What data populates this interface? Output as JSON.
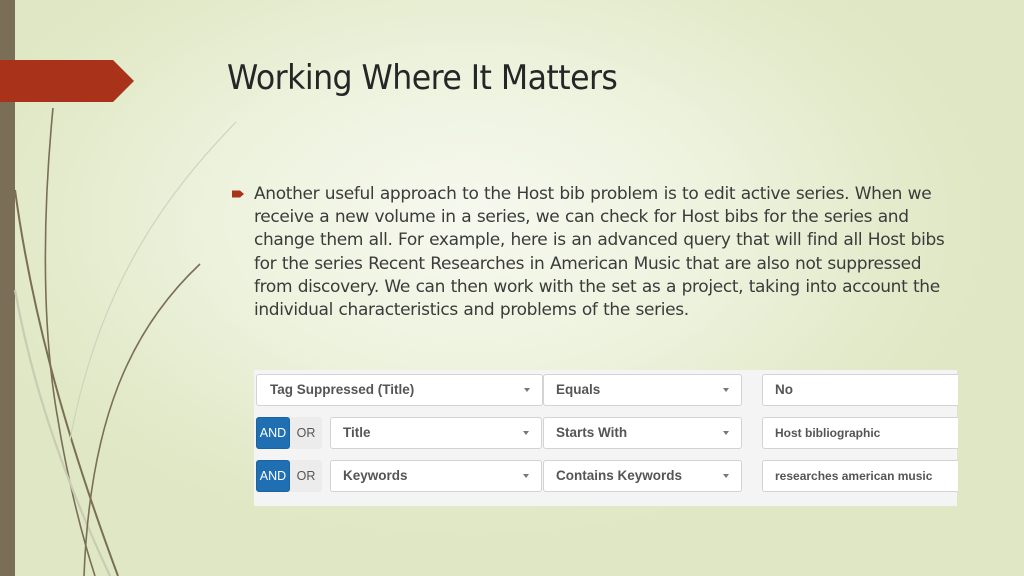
{
  "slide": {
    "title": "Working Where It Matters",
    "bullets": [
      {
        "icon": "arrow-bullet-icon",
        "text": "Another useful approach to the Host bib problem is to edit active series. When we receive a new volume in a series, we can check for Host bibs for the series and change them all.  For example, here is an advanced query that will find all Host bibs for the series Recent Researches in American Music that are also not suppressed from discovery.  We can then work with the set as a project, taking into account the individual characteristics and problems of the series."
      }
    ],
    "colors": {
      "accent": "#a8321a",
      "sidebar": "#7a6e57",
      "background": "#eef3df",
      "text": "#3b3b3b"
    }
  },
  "query_builder": {
    "rows": [
      {
        "field": "Tag Suppressed (Title)",
        "condition": "Equals",
        "value": "No"
      },
      {
        "operator_options": [
          "AND",
          "OR"
        ],
        "operator_selected": "AND",
        "field": "Title",
        "condition": "Starts With",
        "value": "Host bibliographic"
      },
      {
        "operator_options": [
          "AND",
          "OR"
        ],
        "operator_selected": "AND",
        "field": "Keywords",
        "condition": "Contains Keywords",
        "value": "researches american music"
      }
    ],
    "colors": {
      "and_active": "#1f6fb2"
    }
  }
}
